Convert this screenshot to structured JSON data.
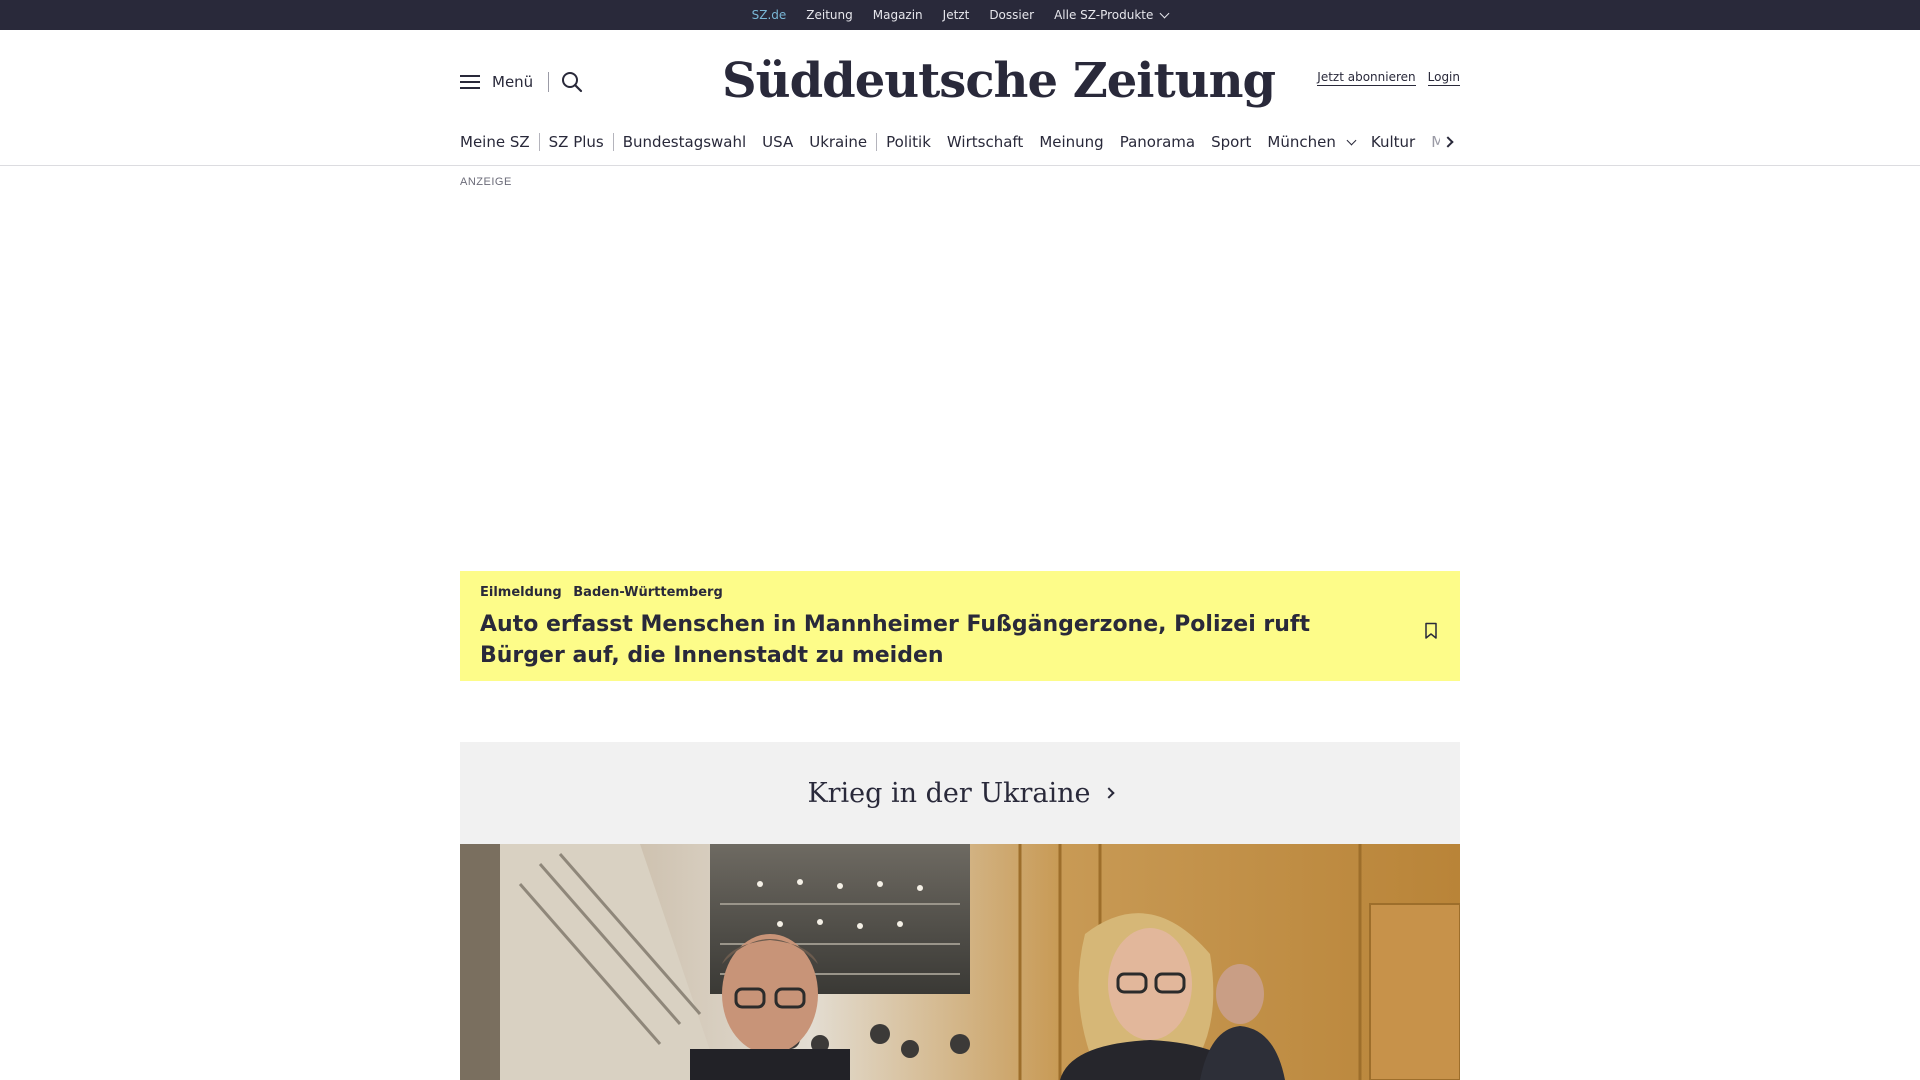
{
  "topbar": {
    "items": [
      {
        "label": "SZ.de",
        "active": true
      },
      {
        "label": "Zeitung"
      },
      {
        "label": "Magazin"
      },
      {
        "label": "Jetzt"
      },
      {
        "label": "Dossier"
      },
      {
        "label": "Alle SZ-Produkte",
        "has_dropdown": true
      }
    ]
  },
  "header": {
    "menu_label": "Menü",
    "logo_text": "Süddeutsche Zeitung",
    "subscribe_label": "Jetzt abonnieren",
    "login_label": "Login"
  },
  "nav": {
    "items": [
      {
        "label": "Meine SZ"
      },
      {
        "label": "SZ Plus"
      },
      {
        "label": "Bundestagswahl"
      },
      {
        "label": "USA"
      },
      {
        "label": "Ukraine"
      },
      {
        "label": "Politik"
      },
      {
        "label": "Wirtschaft"
      },
      {
        "label": "Meinung"
      },
      {
        "label": "Panorama"
      },
      {
        "label": "Sport"
      },
      {
        "label": "München",
        "has_dropdown": true
      },
      {
        "label": "Kultur"
      },
      {
        "label": "M"
      }
    ]
  },
  "ad": {
    "label": "ANZEIGE"
  },
  "breaking": {
    "tag": "Eilmeldung",
    "region": "Baden-Württemberg",
    "headline": "Auto erfasst Menschen in Mannheimer Fußgängerzone, Polizei ruft Bürger auf, die Innenstadt zu meiden"
  },
  "section": {
    "title": "Krieg in der Ukraine"
  },
  "colors": {
    "topbar_bg": "#29293a",
    "active_link": "#7ab7d6",
    "breaking_bg": "#fdfc89",
    "section_bg": "#f1f1f1",
    "text": "#29293a"
  },
  "icons": {
    "menu": "hamburger-icon",
    "search": "search-icon",
    "bookmark": "bookmark-icon",
    "nav_next": "chevron-right-icon"
  }
}
